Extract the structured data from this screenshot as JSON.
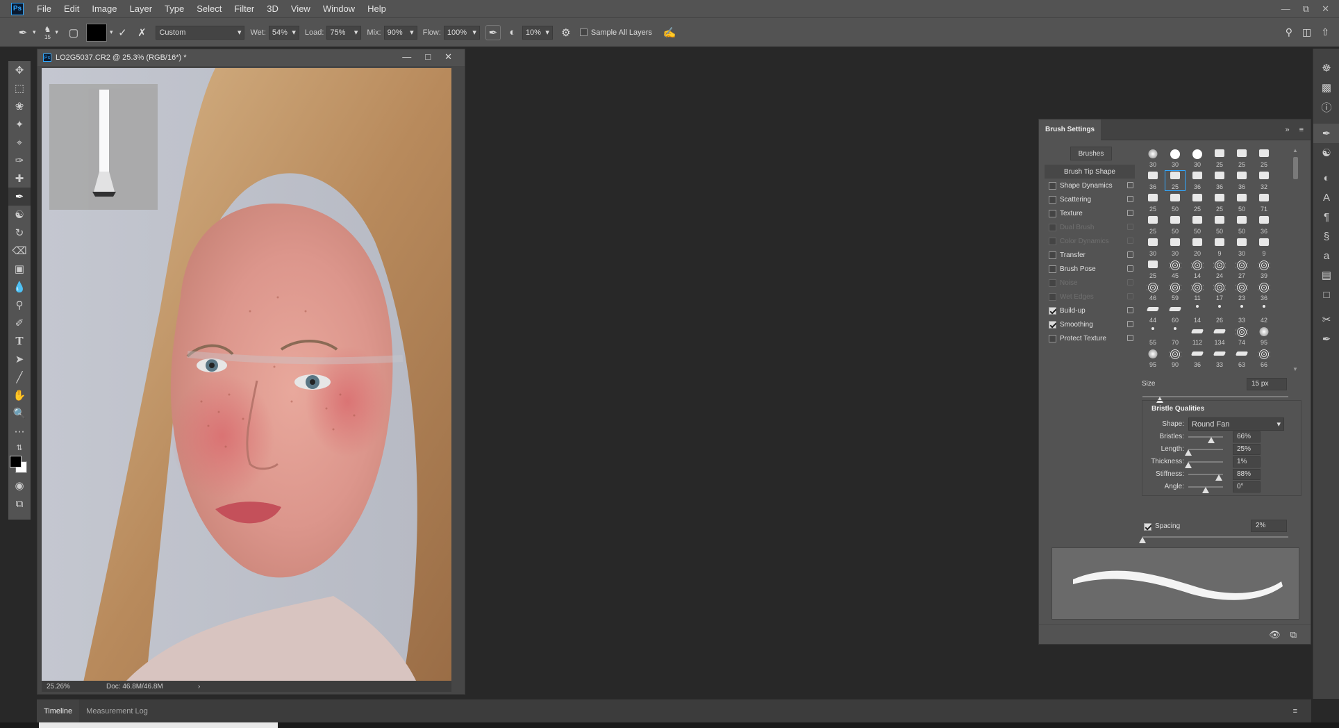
{
  "app": {
    "logo": "Ps"
  },
  "menu": [
    "File",
    "Edit",
    "Image",
    "Layer",
    "Type",
    "Select",
    "Filter",
    "3D",
    "View",
    "Window",
    "Help"
  ],
  "options": {
    "brush_size": "15",
    "preset": "Custom",
    "wet_label": "Wet:",
    "wet_value": "54%",
    "load_label": "Load:",
    "load_value": "75%",
    "mix_label": "Mix:",
    "mix_value": "90%",
    "flow_label": "Flow:",
    "flow_value": "100%",
    "smoothing_value": "10%",
    "sample_all_layers": "Sample All Layers"
  },
  "document": {
    "title": "LO2G5037.CR2 @ 25.3% (RGB/16*) *",
    "zoom": "25.26%",
    "doc_size": "Doc: 46.8M/46.8M"
  },
  "bottom_tabs": [
    "Timeline",
    "Measurement Log"
  ],
  "brush_settings": {
    "tab": "Brush Settings",
    "brushes_button": "Brushes",
    "properties": [
      {
        "label": "Brush Tip Shape",
        "checked": null,
        "enabled": true,
        "selected": true
      },
      {
        "label": "Shape Dynamics",
        "checked": false,
        "enabled": true
      },
      {
        "label": "Scattering",
        "checked": false,
        "enabled": true
      },
      {
        "label": "Texture",
        "checked": false,
        "enabled": true
      },
      {
        "label": "Dual Brush",
        "checked": false,
        "enabled": false
      },
      {
        "label": "Color Dynamics",
        "checked": false,
        "enabled": false
      },
      {
        "label": "Transfer",
        "checked": false,
        "enabled": true
      },
      {
        "label": "Brush Pose",
        "checked": false,
        "enabled": true
      },
      {
        "label": "Noise",
        "checked": false,
        "enabled": false
      },
      {
        "label": "Wet Edges",
        "checked": false,
        "enabled": false
      },
      {
        "label": "Build-up",
        "checked": true,
        "enabled": true
      },
      {
        "label": "Smoothing",
        "checked": true,
        "enabled": true
      },
      {
        "label": "Protect Texture",
        "checked": false,
        "enabled": true
      }
    ],
    "tips": [
      {
        "size": "30",
        "kind": "soft"
      },
      {
        "size": "30",
        "kind": "round"
      },
      {
        "size": "30",
        "kind": "round"
      },
      {
        "size": "25",
        "kind": "flat"
      },
      {
        "size": "25",
        "kind": "flat"
      },
      {
        "size": "25",
        "kind": "flat"
      },
      {
        "size": "36",
        "kind": "flat"
      },
      {
        "size": "25",
        "kind": "flat",
        "selected": true
      },
      {
        "size": "36",
        "kind": "flat"
      },
      {
        "size": "36",
        "kind": "flat"
      },
      {
        "size": "36",
        "kind": "flat"
      },
      {
        "size": "32",
        "kind": "flat"
      },
      {
        "size": "25",
        "kind": "flat"
      },
      {
        "size": "50",
        "kind": "flat"
      },
      {
        "size": "25",
        "kind": "flat"
      },
      {
        "size": "25",
        "kind": "flat"
      },
      {
        "size": "50",
        "kind": "flat"
      },
      {
        "size": "71",
        "kind": "flat"
      },
      {
        "size": "25",
        "kind": "flat"
      },
      {
        "size": "50",
        "kind": "flat"
      },
      {
        "size": "50",
        "kind": "flat"
      },
      {
        "size": "50",
        "kind": "flat"
      },
      {
        "size": "50",
        "kind": "flat"
      },
      {
        "size": "36",
        "kind": "flat"
      },
      {
        "size": "30",
        "kind": "flat"
      },
      {
        "size": "30",
        "kind": "flat"
      },
      {
        "size": "20",
        "kind": "flat"
      },
      {
        "size": "9",
        "kind": "flat"
      },
      {
        "size": "30",
        "kind": "flat"
      },
      {
        "size": "9",
        "kind": "flat"
      },
      {
        "size": "25",
        "kind": "flat"
      },
      {
        "size": "45",
        "kind": "fuzz"
      },
      {
        "size": "14",
        "kind": "fuzz"
      },
      {
        "size": "24",
        "kind": "fuzz"
      },
      {
        "size": "27",
        "kind": "fuzz"
      },
      {
        "size": "39",
        "kind": "fuzz"
      },
      {
        "size": "46",
        "kind": "fuzz"
      },
      {
        "size": "59",
        "kind": "fuzz"
      },
      {
        "size": "11",
        "kind": "fuzz"
      },
      {
        "size": "17",
        "kind": "fuzz"
      },
      {
        "size": "23",
        "kind": "fuzz"
      },
      {
        "size": "36",
        "kind": "fuzz"
      },
      {
        "size": "44",
        "kind": "stroke"
      },
      {
        "size": "60",
        "kind": "stroke"
      },
      {
        "size": "14",
        "kind": "dot"
      },
      {
        "size": "26",
        "kind": "dot"
      },
      {
        "size": "33",
        "kind": "dot"
      },
      {
        "size": "42",
        "kind": "dot"
      },
      {
        "size": "55",
        "kind": "dot"
      },
      {
        "size": "70",
        "kind": "dot"
      },
      {
        "size": "112",
        "kind": "stroke"
      },
      {
        "size": "134",
        "kind": "stroke"
      },
      {
        "size": "74",
        "kind": "fuzz"
      },
      {
        "size": "95",
        "kind": "soft"
      },
      {
        "size": "95",
        "kind": "soft"
      },
      {
        "size": "90",
        "kind": "fuzz"
      },
      {
        "size": "36",
        "kind": "stroke"
      },
      {
        "size": "33",
        "kind": "stroke"
      },
      {
        "size": "63",
        "kind": "stroke"
      },
      {
        "size": "66",
        "kind": "fuzz"
      }
    ],
    "size_label": "Size",
    "size_value": "15 px",
    "size_level": 0.12,
    "bristle_heading": "Bristle Qualities",
    "shape_label": "Shape:",
    "shape_value": "Round Fan",
    "sliders": [
      {
        "label": "Bristles:",
        "value": "66%",
        "level": 0.66
      },
      {
        "label": "Length:",
        "value": "25%",
        "level": 0.0
      },
      {
        "label": "Thickness:",
        "value": "1%",
        "level": 0.0
      },
      {
        "label": "Stiffness:",
        "value": "88%",
        "level": 0.88
      },
      {
        "label": "Angle:",
        "value": "0°",
        "level": 0.5
      }
    ],
    "spacing_label": "Spacing",
    "spacing_checked": true,
    "spacing_value": "2%",
    "spacing_level": 0.0
  }
}
